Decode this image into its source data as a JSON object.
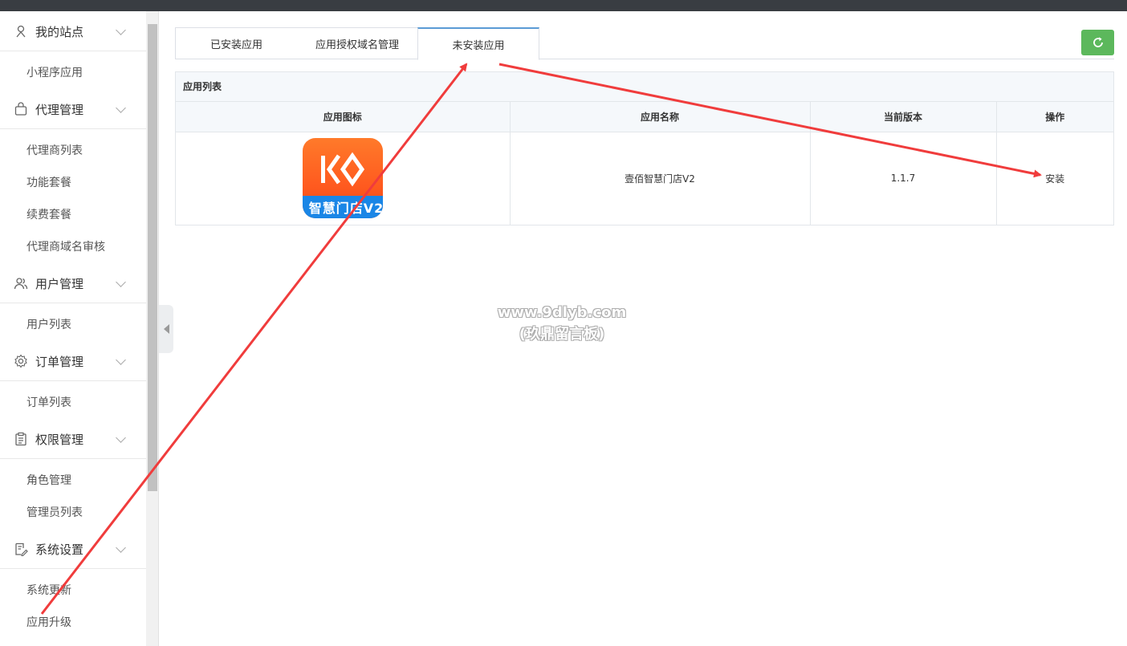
{
  "sidebar": {
    "groups": [
      {
        "label": "我的站点",
        "icon": "person-pin-icon",
        "items": [
          "小程序应用"
        ]
      },
      {
        "label": "代理管理",
        "icon": "bag-icon",
        "items": [
          "代理商列表",
          "功能套餐",
          "续费套餐",
          "代理商域名审核"
        ]
      },
      {
        "label": "用户管理",
        "icon": "users-icon",
        "items": [
          "用户列表"
        ]
      },
      {
        "label": "订单管理",
        "icon": "gear-icon",
        "items": [
          "订单列表"
        ]
      },
      {
        "label": "权限管理",
        "icon": "clipboard-icon",
        "items": [
          "角色管理",
          "管理员列表"
        ]
      },
      {
        "label": "系统设置",
        "icon": "edit-document-icon",
        "items": [
          "系统更新",
          "应用升级"
        ]
      }
    ]
  },
  "tabs": [
    "已安装应用",
    "应用授权域名管理",
    "未安装应用"
  ],
  "active_tab": "未安装应用",
  "panel": {
    "title": "应用列表",
    "columns": [
      "应用图标",
      "应用名称",
      "当前版本",
      "操作"
    ],
    "rows": [
      {
        "icon_label": "智慧门店V2",
        "name": "壹佰智慧门店V2",
        "version": "1.1.7",
        "action": "安装"
      }
    ]
  },
  "watermark": {
    "line1": "www.9dlyb.com",
    "line2": "(玖鼎留言板)"
  },
  "colors": {
    "accent": "#5b9bd5",
    "refresh": "#5cb85c",
    "arrow": "#f03c3c",
    "icon_orange": "#ff5a1f",
    "icon_blue": "#1a86e6"
  }
}
